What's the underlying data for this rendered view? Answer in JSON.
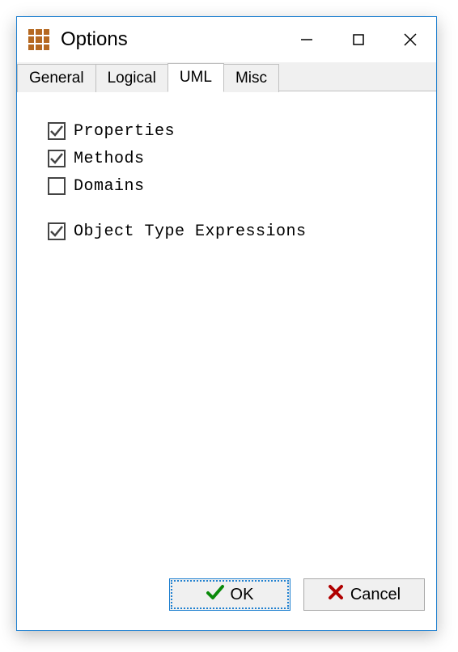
{
  "window": {
    "title": "Options"
  },
  "tabs": [
    {
      "label": "General",
      "active": false
    },
    {
      "label": "Logical",
      "active": false
    },
    {
      "label": "UML",
      "active": true
    },
    {
      "label": "Misc",
      "active": false
    }
  ],
  "checkboxes": {
    "properties": {
      "label": "Properties",
      "checked": true
    },
    "methods": {
      "label": "Methods",
      "checked": true
    },
    "domains": {
      "label": "Domains",
      "checked": false
    },
    "objtype": {
      "label": "Object Type Expressions",
      "checked": true
    }
  },
  "buttons": {
    "ok": {
      "label": "OK"
    },
    "cancel": {
      "label": "Cancel"
    }
  }
}
